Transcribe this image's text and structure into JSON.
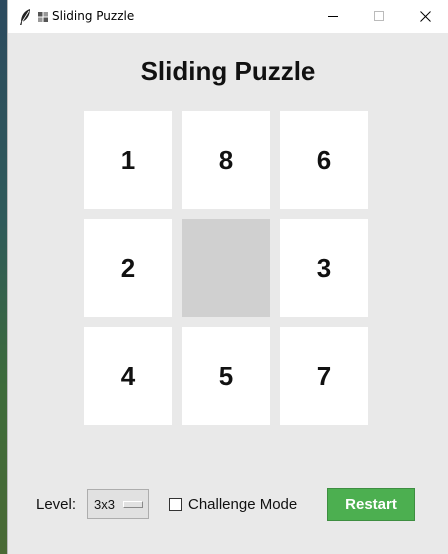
{
  "window": {
    "title": "Sliding Puzzle",
    "app_icon": "puzzle-piece-icon",
    "feather_icon": "feather-icon"
  },
  "heading": "Sliding Puzzle",
  "board": {
    "size": "3x3",
    "tiles": [
      [
        "1",
        "8",
        "6"
      ],
      [
        "2",
        "",
        "3"
      ],
      [
        "4",
        "5",
        "7"
      ]
    ],
    "empty_position": {
      "row": 1,
      "col": 1
    }
  },
  "controls": {
    "level_label": "Level:",
    "level_value": "3x3",
    "challenge_label": "Challenge Mode",
    "challenge_checked": false,
    "restart_label": "Restart"
  },
  "colors": {
    "restart_button": "#4caf50",
    "tile": "#ffffff",
    "empty_tile": "#d0d0d0",
    "window_bg": "#e9e9e9"
  }
}
